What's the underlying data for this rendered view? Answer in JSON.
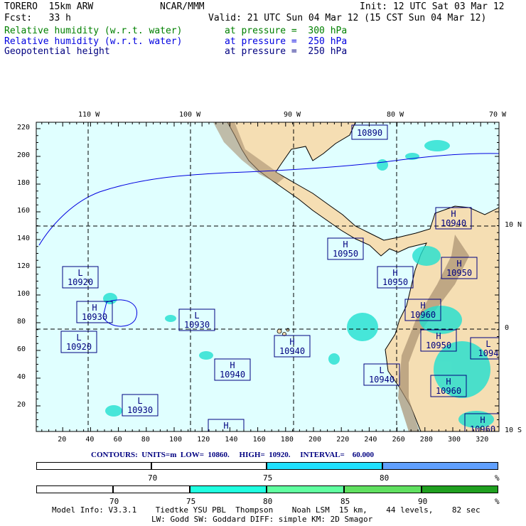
{
  "header": {
    "model": "TORERO  15km ARW",
    "org": "NCAR/MMM",
    "init": "Init: 12 UTC Sat 03 Mar 12",
    "fcst": "Fcst:   33 h",
    "valid": "Valid: 21 UTC Sun 04 Mar 12 (15 CST Sun 04 Mar 12)",
    "fields": [
      {
        "name": "Relative humidity (w.r.t. water)",
        "level": "at pressure =  300 hPa",
        "color": "#008000"
      },
      {
        "name": "Relative humidity (w.r.t. water)",
        "level": "at pressure =  250 hPa",
        "color": "#0000e0"
      },
      {
        "name": "Geopotential height",
        "level": "at pressure =  250 hPa",
        "color": "#000080"
      }
    ]
  },
  "map": {
    "top_labels": [
      "110 W",
      "100 W",
      "90 W",
      "80 W",
      "70 W"
    ],
    "right_labels": [
      "10 N",
      "0",
      "10 S"
    ],
    "y_ticks": [
      "220",
      "200",
      "180",
      "160",
      "140",
      "120",
      "100",
      "80",
      "60",
      "40",
      "20"
    ],
    "x_ticks": [
      "20",
      "40",
      "60",
      "80",
      "100",
      "120",
      "140",
      "160",
      "180",
      "200",
      "220",
      "240",
      "260",
      "280",
      "300",
      "320"
    ],
    "centers": [
      {
        "type": "",
        "value": "10890"
      },
      {
        "type": "L",
        "value": "10920"
      },
      {
        "type": "H",
        "value": "10930"
      },
      {
        "type": "L",
        "value": "10920"
      },
      {
        "type": "L",
        "value": "10930"
      },
      {
        "type": "H",
        "value": "10940"
      },
      {
        "type": "H",
        "value": "10940"
      },
      {
        "type": "L",
        "value": "10930"
      },
      {
        "type": "H",
        "value": ""
      },
      {
        "type": "H",
        "value": "10950"
      },
      {
        "type": "H",
        "value": "10950"
      },
      {
        "type": "H",
        "value": "10940"
      },
      {
        "type": "H",
        "value": "10950"
      },
      {
        "type": "H",
        "value": "10960"
      },
      {
        "type": "H",
        "value": "10950"
      },
      {
        "type": "L",
        "value": "1094"
      },
      {
        "type": "L",
        "value": "10940"
      },
      {
        "type": "H",
        "value": "10960"
      },
      {
        "type": "H",
        "value": "10960"
      }
    ]
  },
  "contours": "CONTOURS:  UNITS=m  LOW=  10860.     HIGH=  10920.     INTERVAL=    60.000",
  "legend250": {
    "labels": [
      "70",
      "75",
      "80",
      "%"
    ],
    "colors": [
      "#ffffff",
      "#ffffff",
      "#20e0ff",
      "#60a0ff"
    ]
  },
  "legend300": {
    "labels": [
      "70",
      "75",
      "80",
      "85",
      "90",
      "%"
    ],
    "colors": [
      "#ffffff",
      "#ffffff",
      "#20ffe0",
      "#60ffa0",
      "#60e060",
      "#20a020"
    ]
  },
  "footer": {
    "line1": "Model Info: V3.3.1    Tiedtke YSU PBL  Thompson    Noah LSM  15 km,    44 levels,    82 sec",
    "line2": "LW: Godd SW: Goddard DIFF: simple KM: 2D Smagor"
  }
}
